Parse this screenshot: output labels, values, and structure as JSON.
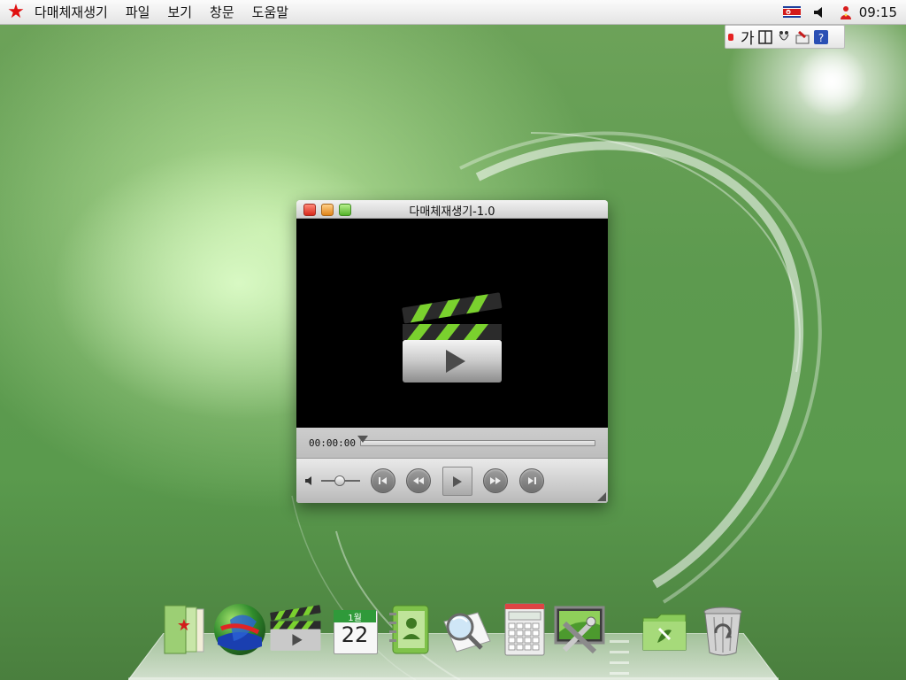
{
  "menubar": {
    "app_title": "다매체재생기",
    "menus": [
      "파일",
      "보기",
      "창문",
      "도움말"
    ],
    "clock": "09:15"
  },
  "ime": {
    "lang_label": "가"
  },
  "player": {
    "title": "다매체재생기-1.0",
    "time": "00:00:00",
    "progress": 0
  },
  "calendar": {
    "month": "1월",
    "day": "22"
  },
  "colors": {
    "accent_green": "#7ad12e",
    "close": "#d8281a",
    "minimize": "#e08418",
    "maximize": "#54b22a",
    "brand_star": "#e01010"
  },
  "dock": {
    "items": [
      {
        "name": "files",
        "icon": "folder-docs-icon"
      },
      {
        "name": "browser",
        "icon": "globe-icon"
      },
      {
        "name": "media-player",
        "icon": "clapperboard-icon"
      },
      {
        "name": "calendar",
        "icon": "calendar-icon"
      },
      {
        "name": "address-book",
        "icon": "contacts-icon"
      },
      {
        "name": "search",
        "icon": "magnifier-icon"
      },
      {
        "name": "calculator",
        "icon": "calculator-icon"
      },
      {
        "name": "settings",
        "icon": "tools-icon"
      },
      {
        "name": "folder",
        "icon": "folder-icon"
      },
      {
        "name": "trash",
        "icon": "trash-icon"
      }
    ]
  }
}
